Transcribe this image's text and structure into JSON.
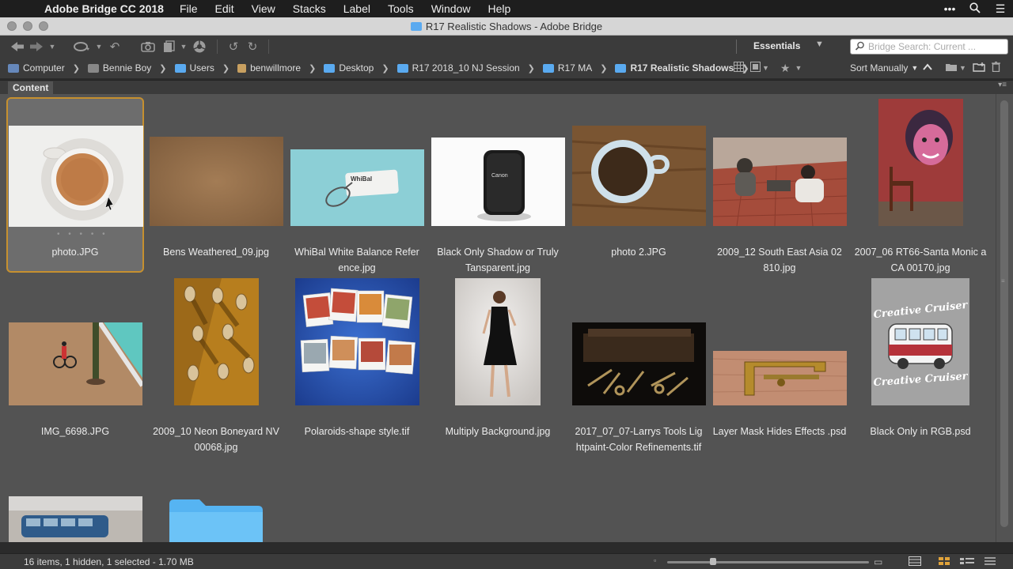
{
  "menubar": {
    "app_name": "Adobe Bridge CC 2018",
    "items": [
      "File",
      "Edit",
      "View",
      "Stacks",
      "Label",
      "Tools",
      "Window",
      "Help"
    ]
  },
  "window": {
    "title": "R17 Realistic Shadows - Adobe Bridge"
  },
  "toolbar": {
    "workspace": "Essentials",
    "search_placeholder": "Bridge Search: Current ..."
  },
  "path": [
    {
      "label": "Computer",
      "icon": "computer-icon"
    },
    {
      "label": "Bennie Boy",
      "icon": "drive-icon"
    },
    {
      "label": "Users",
      "icon": "folder-icon"
    },
    {
      "label": "benwillmore",
      "icon": "home-icon"
    },
    {
      "label": "Desktop",
      "icon": "folder-icon"
    },
    {
      "label": "R17 2018_10 NJ Session",
      "icon": "folder-icon"
    },
    {
      "label": "R17 MA",
      "icon": "folder-icon"
    },
    {
      "label": "R17 Realistic Shadows",
      "icon": "folder-icon"
    }
  ],
  "sort": {
    "label": "Sort Manually"
  },
  "content": {
    "tab_label": "Content",
    "items": [
      {
        "label": "photo.JPG",
        "selected": true,
        "rating_dots": "• • • • •"
      },
      {
        "label": "Bens Weathered_09.jpg"
      },
      {
        "label": "WhiBal White Balance Refer ence.jpg"
      },
      {
        "label": "Black Only Shadow or Truly Tansparent.jpg"
      },
      {
        "label": "photo 2.JPG"
      },
      {
        "label": "2009_12 South East Asia 02 810.jpg"
      },
      {
        "label": "2007_06 RT66-Santa Monic a CA 00170.jpg"
      },
      {
        "label": "IMG_6698.JPG"
      },
      {
        "label": "2009_10 Neon Boneyard NV 00068.jpg"
      },
      {
        "label": "Polaroids-shape style.tif"
      },
      {
        "label": "Multiply Background.jpg"
      },
      {
        "label": "2017_07_07-Larrys Tools Lig htpaint-Color Refinements.tif"
      },
      {
        "label": "Layer Mask Hides Effects .psd"
      },
      {
        "label": "Black Only in RGB.psd"
      },
      {
        "label": ""
      },
      {
        "label": ""
      }
    ],
    "logo_text_top": "Creative Cruiser",
    "logo_text_bottom": "Creative Cruiser",
    "whibal_text": "WhiBal"
  },
  "status": {
    "text": "16 items, 1 hidden, 1 selected - 1.70 MB"
  },
  "colors": {
    "selection": "#c6902f",
    "panel": "#535353",
    "folder": "#5aaaf0"
  }
}
